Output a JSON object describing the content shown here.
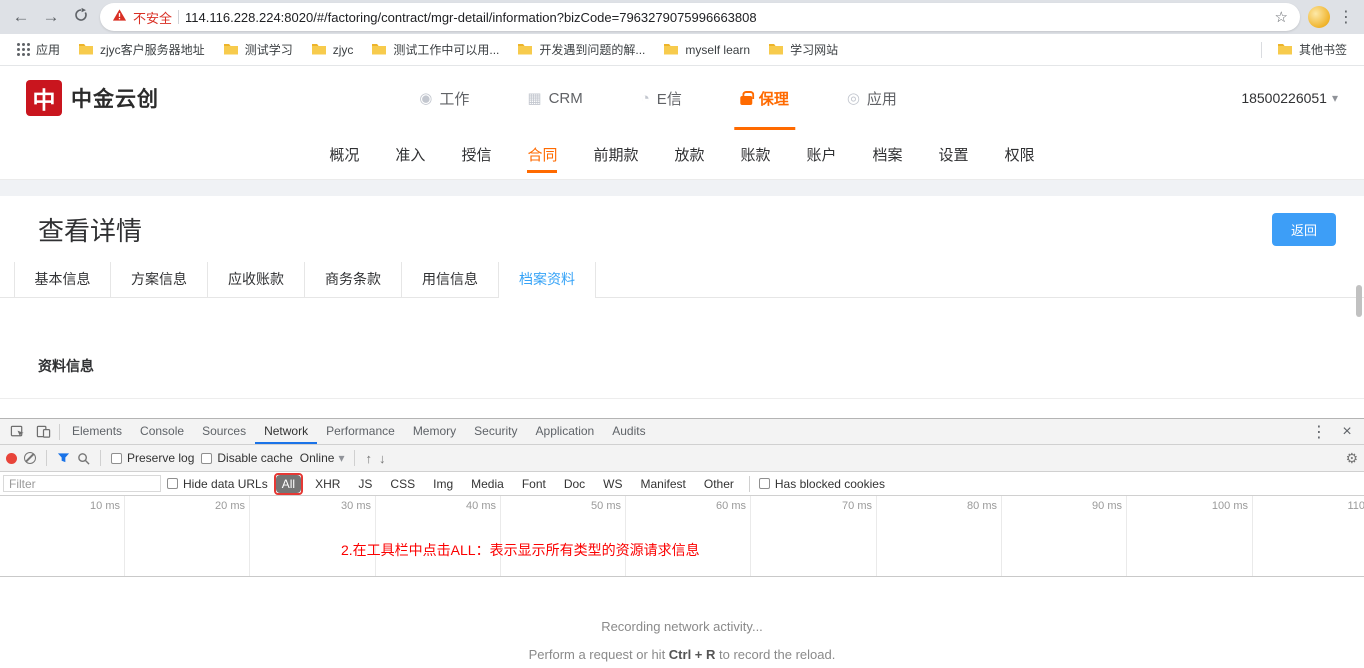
{
  "colors": {
    "brand_red": "#c9151e",
    "accent_orange": "#ff6a00",
    "active_tab_blue": "#36a3f7",
    "button_blue": "#3d9ef7",
    "warning_red": "#d93025",
    "annotation_red": "#fb0000",
    "devtools_accent_blue": "#1a73e8"
  },
  "browser": {
    "security_label": "不安全",
    "url": "114.116.228.224:8020/#/factoring/contract/mgr-detail/information?bizCode=7963279075996663808",
    "apps_label": "应用",
    "bookmarks": [
      {
        "label": "zjyc客户服务器地址"
      },
      {
        "label": "测试学习"
      },
      {
        "label": "zjyc"
      },
      {
        "label": "测试工作中可以用..."
      },
      {
        "label": "开发遇到问题的解..."
      },
      {
        "label": "myself learn"
      },
      {
        "label": "学习网站"
      }
    ],
    "other_bookmarks_label": "其他书签"
  },
  "site": {
    "logo_mark_char": "中",
    "logo_text": "中金云创",
    "nav": [
      {
        "label": "工作",
        "active": false
      },
      {
        "label": "CRM",
        "active": false
      },
      {
        "label": "E信",
        "active": false
      },
      {
        "label": "保理",
        "active": true
      },
      {
        "label": "应用",
        "active": false
      }
    ],
    "account": "18500226051",
    "sub_nav": [
      {
        "label": "概况",
        "active": false
      },
      {
        "label": "准入",
        "active": false
      },
      {
        "label": "授信",
        "active": false
      },
      {
        "label": "合同",
        "active": true
      },
      {
        "label": "前期款",
        "active": false
      },
      {
        "label": "放款",
        "active": false
      },
      {
        "label": "账款",
        "active": false
      },
      {
        "label": "账户",
        "active": false
      },
      {
        "label": "档案",
        "active": false
      },
      {
        "label": "设置",
        "active": false
      },
      {
        "label": "权限",
        "active": false
      }
    ],
    "page_title": "查看详情",
    "back_button_label": "返回",
    "detail_tabs": [
      {
        "label": "基本信息",
        "active": false
      },
      {
        "label": "方案信息",
        "active": false
      },
      {
        "label": "应收账款",
        "active": false
      },
      {
        "label": "商务条款",
        "active": false
      },
      {
        "label": "用信信息",
        "active": false
      },
      {
        "label": "档案资料",
        "active": true
      }
    ],
    "section_title": "资料信息"
  },
  "devtools": {
    "tabs": [
      {
        "label": "Elements",
        "active": false
      },
      {
        "label": "Console",
        "active": false
      },
      {
        "label": "Sources",
        "active": false
      },
      {
        "label": "Network",
        "active": true
      },
      {
        "label": "Performance",
        "active": false
      },
      {
        "label": "Memory",
        "active": false
      },
      {
        "label": "Security",
        "active": false
      },
      {
        "label": "Application",
        "active": false
      },
      {
        "label": "Audits",
        "active": false
      }
    ],
    "toolbar": {
      "preserve_log_label": "Preserve log",
      "preserve_log_checked": false,
      "disable_cache_label": "Disable cache",
      "disable_cache_checked": false,
      "throttling_value": "Online"
    },
    "filter_bar": {
      "filter_placeholder": "Filter",
      "filter_value": "",
      "hide_data_urls_label": "Hide data URLs",
      "hide_data_urls_checked": false,
      "type_filters": [
        {
          "label": "All",
          "active": true
        },
        {
          "label": "XHR",
          "active": false
        },
        {
          "label": "JS",
          "active": false
        },
        {
          "label": "CSS",
          "active": false
        },
        {
          "label": "Img",
          "active": false
        },
        {
          "label": "Media",
          "active": false
        },
        {
          "label": "Font",
          "active": false
        },
        {
          "label": "Doc",
          "active": false
        },
        {
          "label": "WS",
          "active": false
        },
        {
          "label": "Manifest",
          "active": false
        },
        {
          "label": "Other",
          "active": false
        }
      ],
      "has_blocked_cookies_label": "Has blocked cookies",
      "has_blocked_cookies_checked": false
    },
    "timeline": {
      "ticks": [
        "10 ms",
        "20 ms",
        "30 ms",
        "40 ms",
        "50 ms",
        "60 ms",
        "70 ms",
        "80 ms",
        "90 ms",
        "100 ms",
        "110"
      ]
    },
    "annotation_text": "2.在工具栏中点击ALL：表示显示所有类型的资源请求信息",
    "empty_state": {
      "line1": "Recording network activity...",
      "line2_prefix": "Perform a request or hit ",
      "line2_key": "Ctrl + R",
      "line2_suffix": " to record the reload."
    }
  }
}
